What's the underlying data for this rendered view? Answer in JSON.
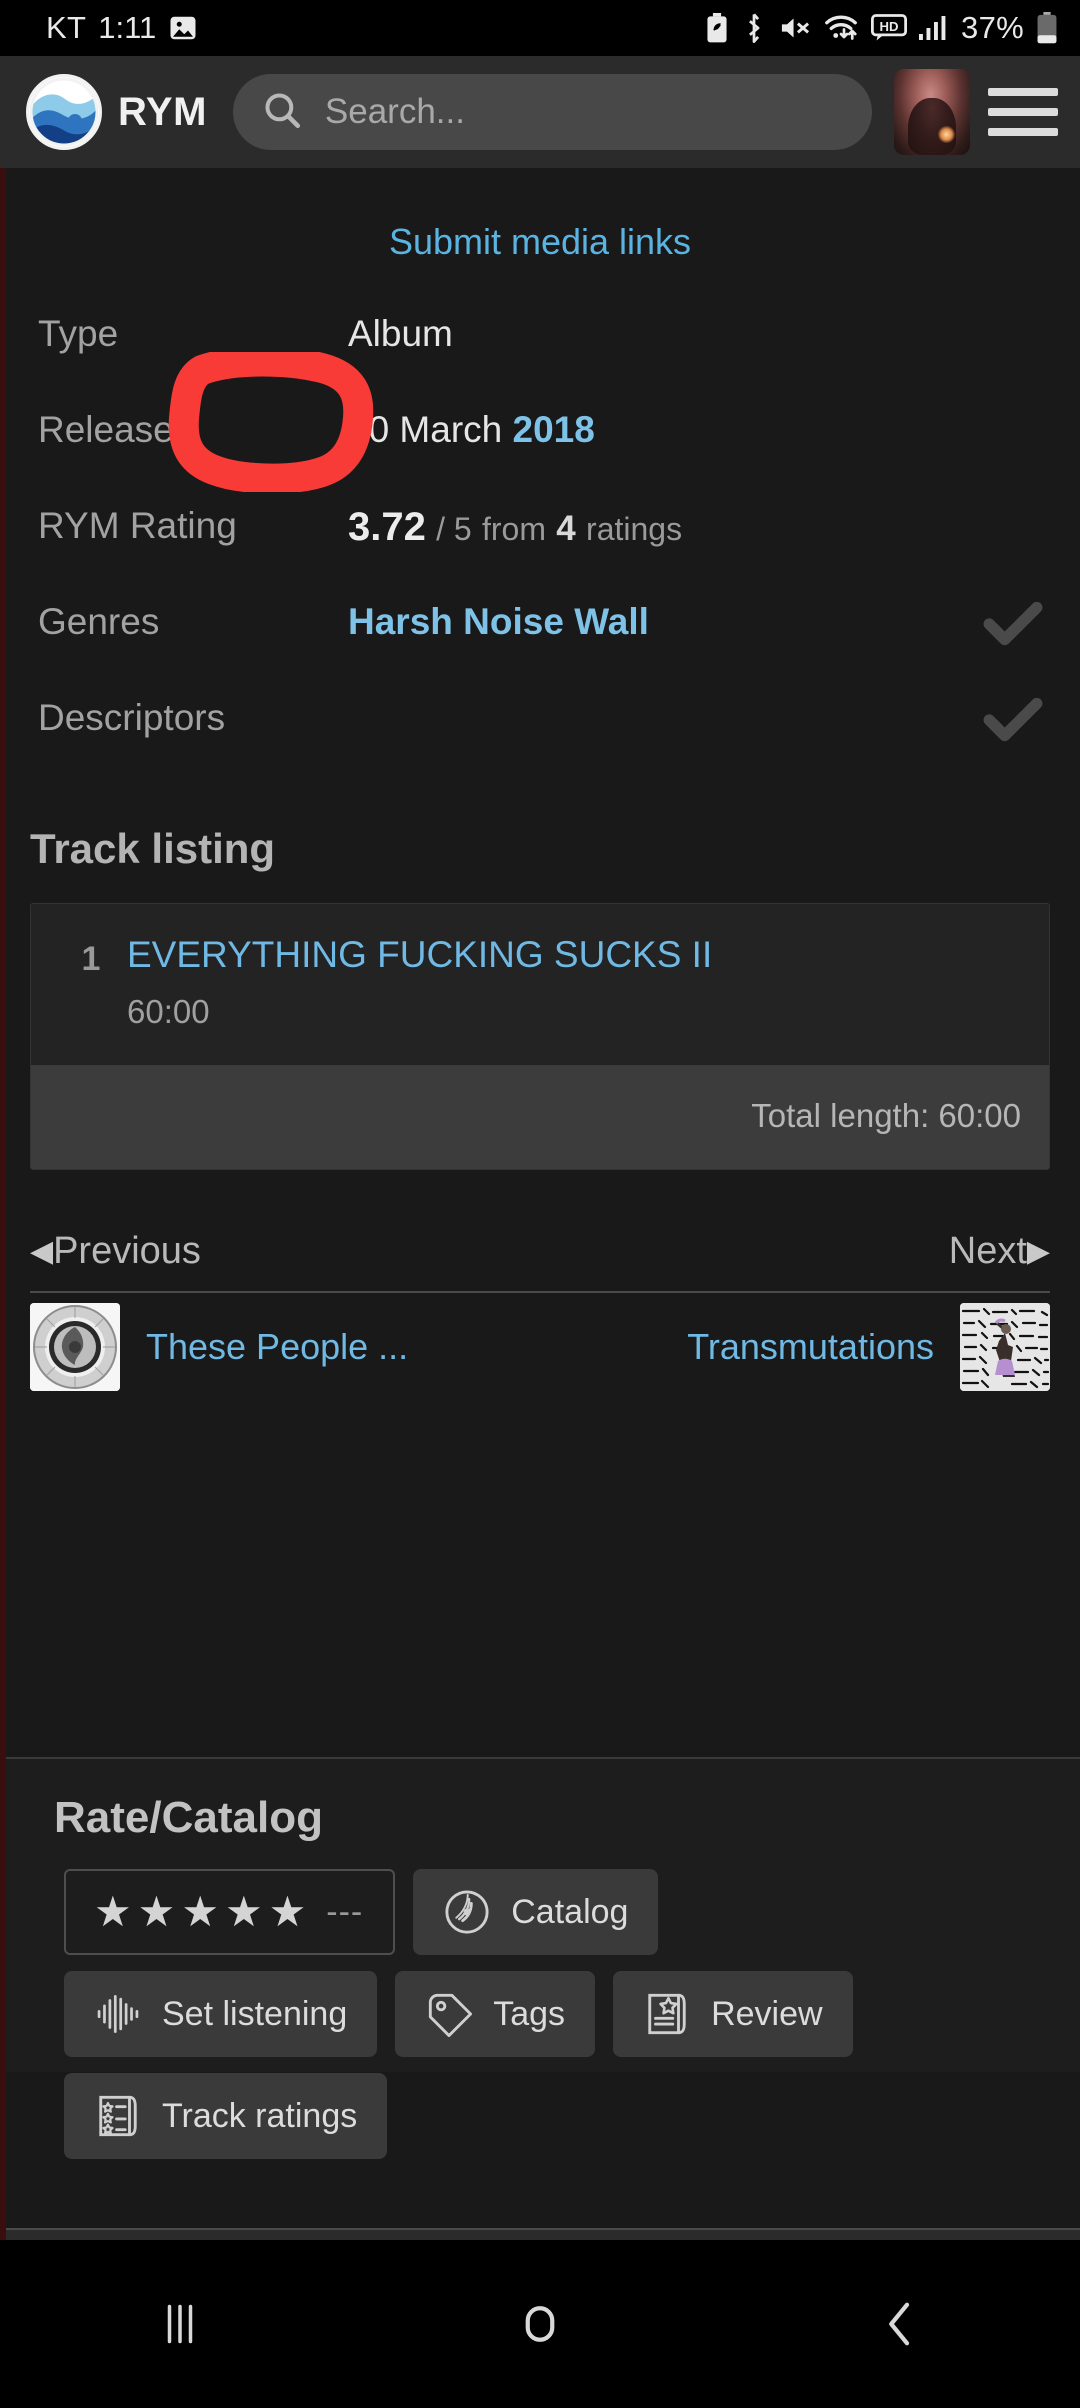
{
  "status_bar": {
    "carrier": "KT",
    "clock": "1:11",
    "battery_percent": "37%",
    "icons": [
      "image-icon",
      "battery-saver-icon",
      "bluetooth-icon",
      "mute-icon",
      "wifi-icon",
      "hd-icon",
      "signal-bars-icon",
      "battery-icon"
    ]
  },
  "header": {
    "brand": "RYM",
    "logo_icon": "rym-wave-logo-icon",
    "search_placeholder": "Search...",
    "search_value": "",
    "search_icon": "search-icon",
    "avatar_icon": "user-avatar",
    "menu_icon": "hamburger-menu-icon"
  },
  "colors": {
    "accent_blue": "#6fb9e4",
    "link_blue": "#5ab3e0",
    "page_bg": "#191919",
    "appbar_bg": "#2b2b2b",
    "annotation_red": "#f93b38",
    "check_gray": "#4a4a4a"
  },
  "submit_link": "Submit media links",
  "info": {
    "rows": [
      {
        "label": "Type",
        "value": "Album",
        "kind": "plain",
        "check": false
      },
      {
        "label": "Released",
        "date": "10 March",
        "year": "2018",
        "kind": "released",
        "check": false
      },
      {
        "label": "RYM Rating",
        "rating": "3.72",
        "scale": "/ 5",
        "from": "from",
        "count": "4",
        "unit": "ratings",
        "kind": "rating",
        "check": false
      },
      {
        "label": "Genres",
        "value": "Harsh Noise Wall",
        "kind": "genre",
        "check": true
      },
      {
        "label": "Descriptors",
        "value": "",
        "kind": "plain",
        "check": true
      }
    ],
    "check_icon": "checkmark-icon"
  },
  "track_listing": {
    "title": "Track listing",
    "tracks": [
      {
        "num": "1",
        "title": "EVERYTHING FUCKING SUCKS II",
        "length": "60:00"
      }
    ],
    "total_label": "Total length: 60:00"
  },
  "prev_next": {
    "previous_label": "Previous",
    "next_label": "Next",
    "prev_arrow_icon": "triangle-left-icon",
    "next_arrow_icon": "triangle-right-icon",
    "prev_album": "These People ...",
    "next_album": "Transmutations",
    "prev_thumb_icon": "album-cover-thumbnail",
    "next_thumb_icon": "album-cover-thumbnail"
  },
  "rate_catalog": {
    "title": "Rate/Catalog",
    "stars": "★★★★★",
    "star_value": "---",
    "buttons": [
      {
        "label": "Catalog",
        "icon": "vinyl-record-icon"
      },
      {
        "label": "Set listening",
        "icon": "waveform-icon"
      },
      {
        "label": "Tags",
        "icon": "tag-icon"
      },
      {
        "label": "Review",
        "icon": "review-document-icon"
      },
      {
        "label": "Track ratings",
        "icon": "track-ratings-list-icon"
      }
    ]
  },
  "annotation": {
    "shape": "hand-drawn-red-circle",
    "color": "#f93b38"
  },
  "nav_bar": {
    "recents_icon": "recents-icon",
    "home_icon": "home-icon",
    "back_icon": "back-icon"
  }
}
